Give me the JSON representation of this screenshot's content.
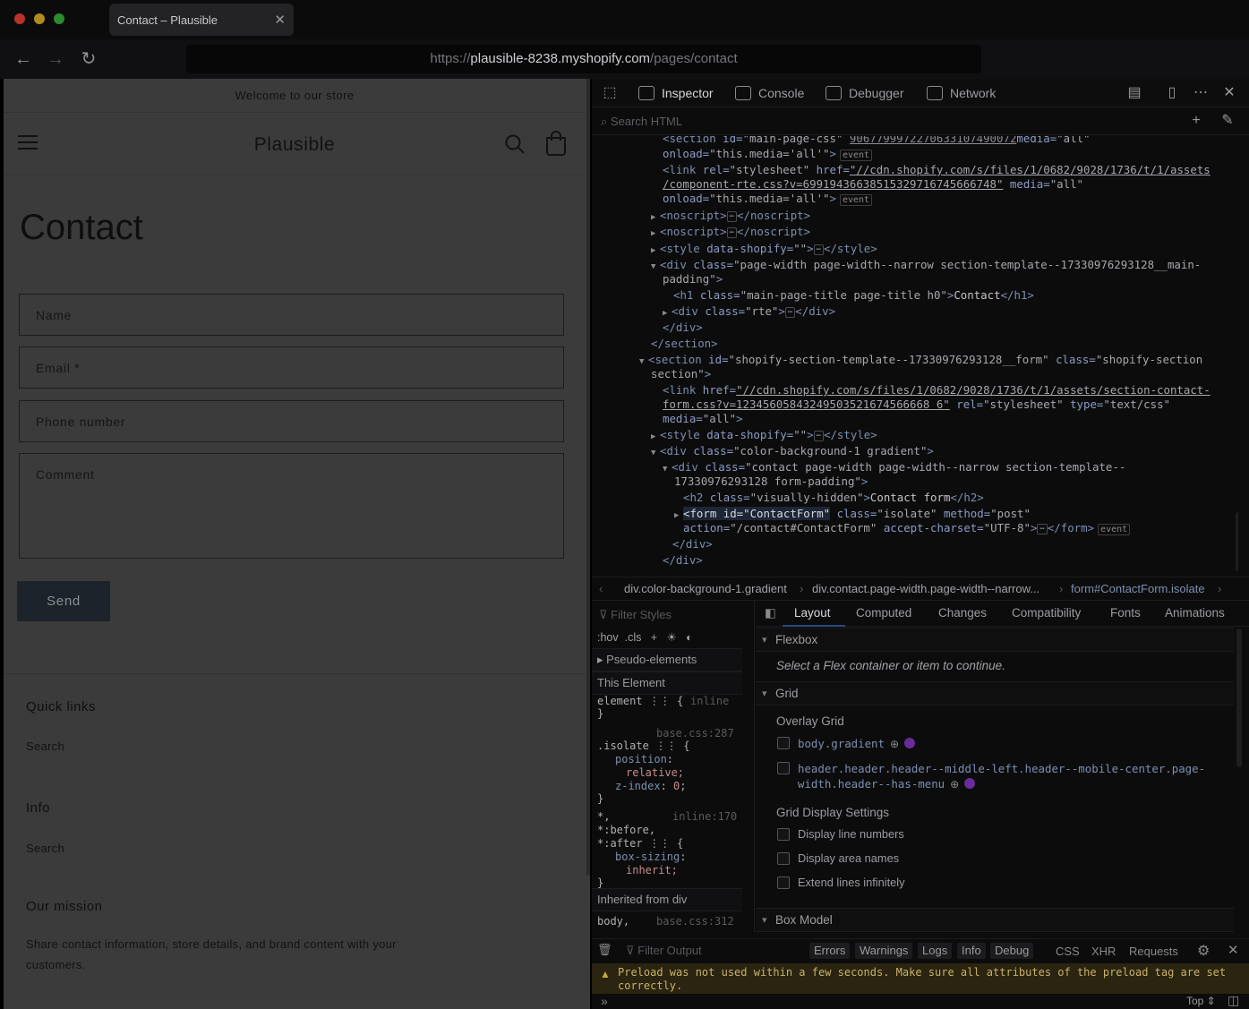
{
  "browser": {
    "tab_title": "Contact – Plausible",
    "url_prefix": "https://",
    "url_host": "plausible-8238.myshopify.com",
    "url_path": "/pages/contact"
  },
  "page": {
    "announcement": "Welcome to our store",
    "brand": "Plausible",
    "title": "Contact",
    "fields": {
      "name": "Name",
      "email": "Email *",
      "phone": "Phone number",
      "comment": "Comment"
    },
    "send_label": "Send",
    "footer": {
      "quick_links_heading": "Quick links",
      "quick_links_item": "Search",
      "info_heading": "Info",
      "info_item": "Search",
      "mission_heading": "Our mission",
      "mission_text": "Share contact information, store details, and brand content with your customers."
    }
  },
  "devtools": {
    "tabs": [
      "Inspector",
      "Console",
      "Debugger",
      "Network"
    ],
    "search_placeholder": "Search HTML",
    "breadcrumbs": [
      "div.color-background-1.gradient",
      "div.contact.page-width.page-width--narrow...",
      "form#ContactForm.isolate"
    ],
    "rules": {
      "filter_placeholder": "Filter Styles",
      "hov": ":hov",
      "cls": ".cls",
      "pseudo": "Pseudo-elements",
      "this_element": "This Element",
      "element_sel": "element",
      "element_src": "inline",
      "r1_src": "base.css:287",
      "r1_sel": ".isolate",
      "r1_p1": "position",
      "r1_v1": "relative",
      "r1_p2": "z-index",
      "r1_v2": "0",
      "r2_src": "inline:170",
      "r2_sel_a": "*,",
      "r2_sel_b": "*:before,",
      "r2_sel_c": "*:after",
      "r2_p1": "box-sizing",
      "r2_v1": "inherit",
      "inherited": "Inherited from div",
      "r3_sel": "body,",
      "r3_src": "base.css:312"
    },
    "layout": {
      "tabs": [
        "Layout",
        "Computed",
        "Changes",
        "Compatibility",
        "Fonts",
        "Animations"
      ],
      "flexbox": "Flexbox",
      "flex_msg": "Select a Flex container or item to continue.",
      "grid": "Grid",
      "overlay_grid": "Overlay Grid",
      "grid_item_1": "body.gradient",
      "grid_item_2": "header.header.header--middle-left.header--mobile-center.page-width.header--has-menu",
      "display_settings": "Grid Display Settings",
      "opt_1": "Display line numbers",
      "opt_2": "Display area names",
      "opt_3": "Extend lines infinitely",
      "box_model": "Box Model"
    },
    "console": {
      "filter_placeholder": "Filter Output",
      "filters": [
        "Errors",
        "Warnings",
        "Logs",
        "Info",
        "Debug"
      ],
      "filters_2": [
        "CSS",
        "XHR",
        "Requests"
      ],
      "warning": "Preload was not used within a few seconds. Make sure all attributes of the preload tag are set correctly.",
      "context": "Top ⇕"
    }
  }
}
